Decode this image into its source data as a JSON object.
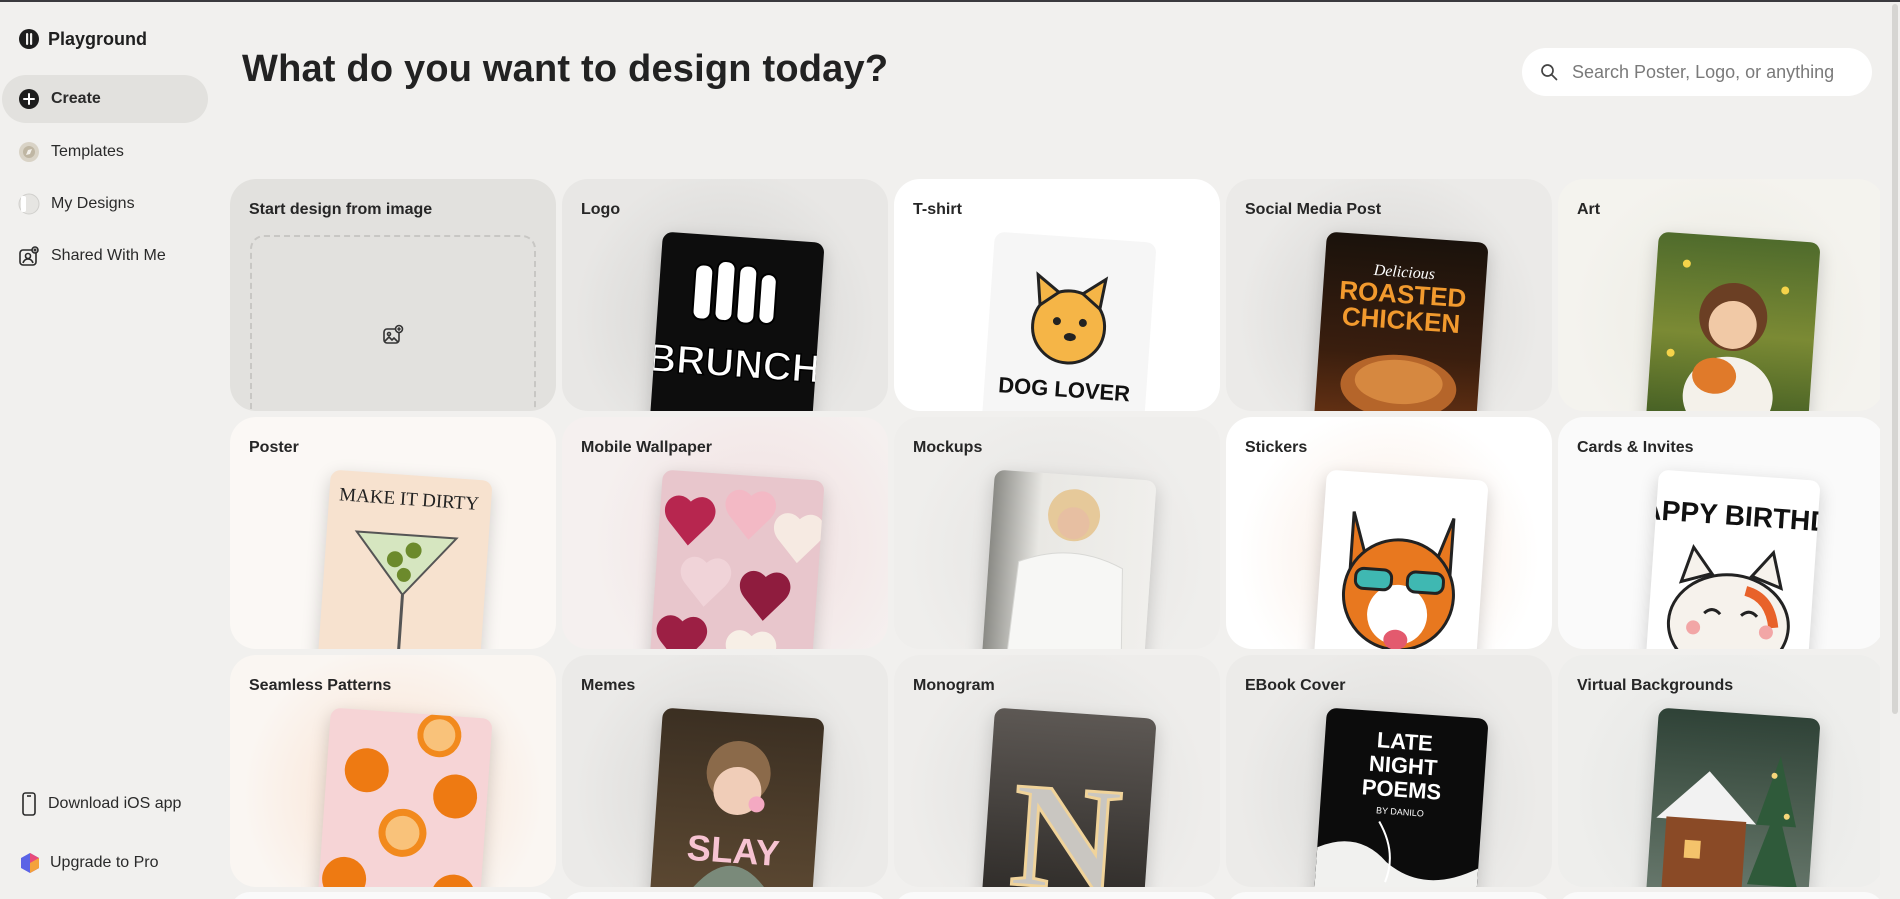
{
  "app": {
    "name": "Playground"
  },
  "sidebar": {
    "items": [
      {
        "label": "Create",
        "icon": "plus-circle-icon",
        "active": true
      },
      {
        "label": "Templates",
        "icon": "compass-icon",
        "active": false
      },
      {
        "label": "My Designs",
        "icon": "folder-icon",
        "active": false
      },
      {
        "label": "Shared With Me",
        "icon": "shared-icon",
        "active": false
      }
    ],
    "bottom": [
      {
        "label": "Download iOS app",
        "icon": "phone-icon"
      },
      {
        "label": "Upgrade to Pro",
        "icon": "pro-badge-icon"
      }
    ]
  },
  "header": {
    "title": "What do you want to design today?",
    "search_placeholder": "Search Poster, Logo, or anything"
  },
  "cards": [
    {
      "label": "Start design from image",
      "thumb": "upload"
    },
    {
      "label": "Logo",
      "thumb": "brunch-logo",
      "thumb_text": "BRUNCH"
    },
    {
      "label": "T-shirt",
      "thumb": "dog-lover-shirt",
      "thumb_text": "DOG LOVER"
    },
    {
      "label": "Social Media Post",
      "thumb": "roasted-chicken",
      "thumb_text_1": "Delicious",
      "thumb_text_2": "ROASTED",
      "thumb_text_3": "CHICKEN"
    },
    {
      "label": "Art",
      "thumb": "girl-fox-art"
    },
    {
      "label": "Poster",
      "thumb": "martini-poster",
      "thumb_text": "MAKE IT DIRTY"
    },
    {
      "label": "Mobile Wallpaper",
      "thumb": "hearts-wallpaper"
    },
    {
      "label": "Mockups",
      "thumb": "sweater-mockup"
    },
    {
      "label": "Stickers",
      "thumb": "corgi-sticker"
    },
    {
      "label": "Cards & Invites",
      "thumb": "birthday-card",
      "thumb_text": "APPY BIRTHD"
    },
    {
      "label": "Seamless Patterns",
      "thumb": "orange-pattern"
    },
    {
      "label": "Memes",
      "thumb": "slay-meme",
      "thumb_text": "SLAY"
    },
    {
      "label": "Monogram",
      "thumb": "n-monogram",
      "thumb_text": "N"
    },
    {
      "label": "EBook Cover",
      "thumb": "late-night-poems",
      "thumb_text_1": "LATE",
      "thumb_text_2": "NIGHT",
      "thumb_text_3": "POEMS",
      "thumb_text_4": "BY DANILO"
    },
    {
      "label": "Virtual Backgrounds",
      "thumb": "cabin-background"
    }
  ],
  "colors": {
    "background": "#f1f0ee",
    "active_nav": "#e2e1de",
    "text": "#222222"
  }
}
